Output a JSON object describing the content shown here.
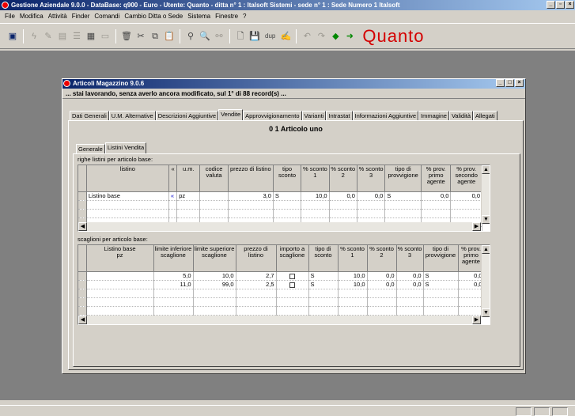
{
  "app": {
    "title": "Gestione Aziendale 9.0.0 - DataBase: q900 - Euro - Utente: Quanto - ditta n° 1 : Italsoft Sistemi - sede n° 1 : Sede Numero 1 Italsoft",
    "menu": [
      "File",
      "Modifica",
      "Attività",
      "Finder",
      "Comandi",
      "Cambio Ditta o Sede",
      "Sistema",
      "Finestre",
      "?"
    ],
    "toolbar_dup": "dup",
    "brand": "Quanto",
    "brand_color": "#d40000"
  },
  "window": {
    "title": "Articoli Magazzino 9.0.6",
    "status_msg": "... stai lavorando, senza averlo ancora modificato, sul 1° di 88 record(s) ...",
    "tabs": [
      "Dati Generali",
      "U.M. Alternative",
      "Descrizioni Aggiuntive",
      "Vendite",
      "Approvvigionamento",
      "Varianti",
      "Intrastat",
      "Informazioni Aggiuntive",
      "Immagine",
      "Validità",
      "Allegati"
    ],
    "active_tab": "Vendite",
    "article": "0 1 Articolo uno",
    "subtabs": [
      "Generale",
      "Listini Vendita"
    ],
    "active_subtab": "Listini Vendita"
  },
  "listini": {
    "label": "righe listini per articolo base:",
    "headers": [
      "listino",
      "«",
      "u.m.",
      "codice valuta",
      "prezzo di listino",
      "tipo sconto",
      "% sconto 1",
      "% sconto 2",
      "% sconto 3",
      "tipo di provvigione",
      "% prov. primo agente",
      "% prov. secondo agente"
    ],
    "rows": [
      [
        "Listino base",
        "«",
        "pz",
        "",
        "3,0",
        "S",
        "10,0",
        "0,0",
        "0,0",
        "S",
        "0,0",
        "0,0"
      ]
    ]
  },
  "scaglioni": {
    "label": "scaglioni per articolo base:",
    "col0": [
      "Listino base",
      "pz"
    ],
    "headers": [
      "limite inferiore scaglione",
      "limite superiore scaglione",
      "prezzo di listino",
      "importo a scaglione",
      "tipo di sconto",
      "% sconto 1",
      "% sconto 2",
      "% sconto 3",
      "tipo di provvigione",
      "% prov. primo agente"
    ],
    "rows": [
      [
        "5,0",
        "10,0",
        "2,7",
        "",
        "S",
        "10,0",
        "0,0",
        "0,0",
        "S",
        "0,0"
      ],
      [
        "11,0",
        "99,0",
        "2,5",
        "",
        "S",
        "10,0",
        "0,0",
        "0,0",
        "S",
        "0,0"
      ]
    ]
  }
}
